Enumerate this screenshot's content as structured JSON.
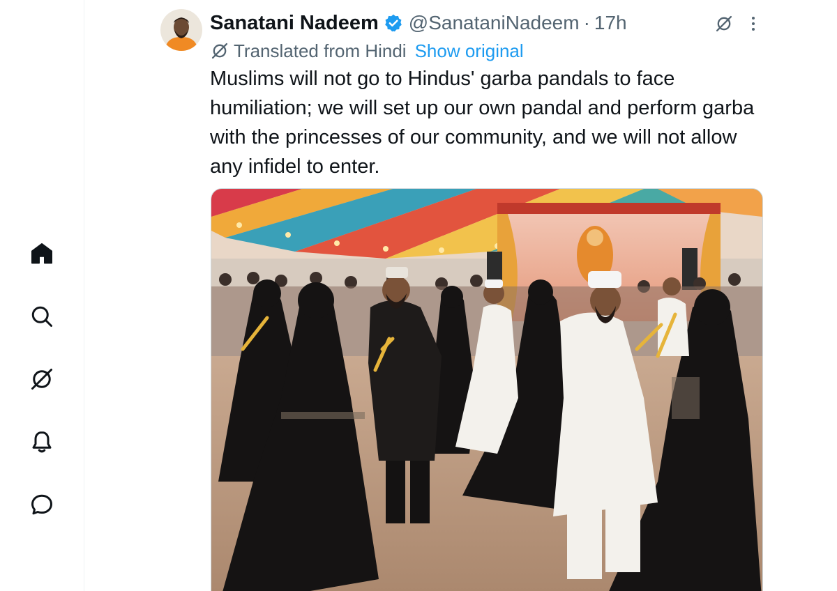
{
  "nav": {
    "items": [
      {
        "name": "home",
        "icon": "home-icon"
      },
      {
        "name": "explore",
        "icon": "search-icon"
      },
      {
        "name": "grok",
        "icon": "grok-icon"
      },
      {
        "name": "notifications",
        "icon": "bell-icon"
      },
      {
        "name": "messages",
        "icon": "chat-bubble-icon"
      }
    ]
  },
  "tweet": {
    "display_name": "Sanatani Nadeem",
    "verified": true,
    "handle": "@SanataniNadeem",
    "separator": "·",
    "time": "17h",
    "translated_label": "Translated from Hindi",
    "show_original": "Show original",
    "text": "Muslims will not go to Hindus' garba pandals to face humiliation; we will set up our own pandal and perform garba with the princesses of our community, and we will not allow any infidel to enter.",
    "media": {
      "type": "photo",
      "icon": "photo"
    }
  },
  "colors": {
    "accent": "#1d9bf0",
    "secondary_text": "#536471",
    "primary_text": "#0f1419",
    "avatar_bg": "#f08a24"
  }
}
